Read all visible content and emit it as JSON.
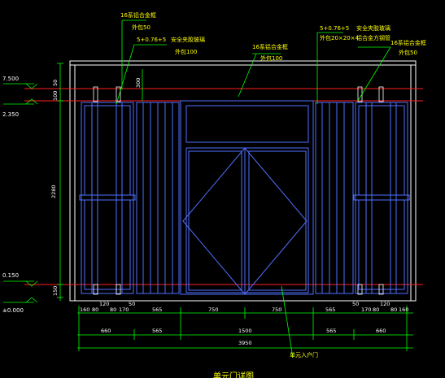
{
  "colors": {
    "background": "#000000",
    "frame": "#ffffff",
    "glass": "#4f6fff",
    "level_line": "#ff2020",
    "leader": "#00ff00",
    "annotation": "#ffff00",
    "dimension": "#00ff00",
    "text": "#ffffff"
  },
  "annotations": {
    "top_left_1": "16系铝合金框",
    "top_left_1_sub": "外包50",
    "top_left_2": "5+0.76+5",
    "top_left_3": "安全夹胶玻璃",
    "top_left_3_sub": "外包100",
    "top_center": "16系铝合金框",
    "top_center_sub": "外包100",
    "top_right_1": "5+0.76+5",
    "top_right_2": "安全夹胶玻璃",
    "top_right_3": "外包20×20×4",
    "top_right_4": "铝合金方钢管",
    "top_right_5": "16系铝合金框",
    "top_right_5_sub": "外包50",
    "bottom_door": "单元入户门"
  },
  "levels": {
    "top": "7.500",
    "second": "2.350",
    "third": "0.150",
    "ground": "±0.000"
  },
  "dims": {
    "left_top1": "50",
    "left_top2": "100",
    "left_top3": "300",
    "left_height": "2280",
    "left_bottom": "150",
    "row1": [
      "160",
      "80",
      "120",
      "80",
      "170",
      "50",
      "565",
      "750",
      "750",
      "565",
      "50",
      "170",
      "80",
      "120",
      "80",
      "160"
    ],
    "row2": [
      "660",
      "565",
      "1500",
      "565",
      "660"
    ],
    "total": "3950"
  },
  "title": "单元门详图"
}
